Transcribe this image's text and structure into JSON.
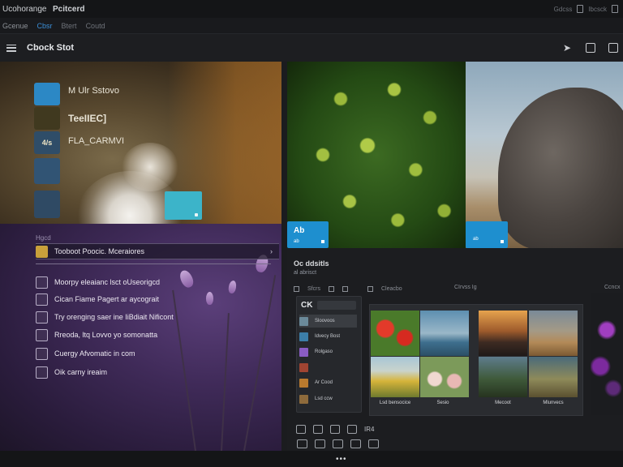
{
  "menubar": {
    "item1": "Ucohorange",
    "item2": "Pcitcerd",
    "right": [
      "Gdcss",
      "Ibcsck"
    ]
  },
  "tabbar": {
    "tabs": [
      "Gcenue",
      "Cbsr",
      "Btert",
      "Coutd"
    ]
  },
  "header": {
    "title": "Cbock Stot"
  },
  "top_left": {
    "labels": [
      "M Ulr Sstovo",
      "TeeIIEC]",
      "FLA_CARMVI"
    ],
    "tiles": [
      "",
      "",
      "4/s",
      "",
      ""
    ]
  },
  "list": {
    "heading": "Hgcd",
    "active": "Tooboot Poocic. Mceraiores",
    "items": [
      "Moorpy eleaianc lsct oUseorigcd",
      "Cican Fiame Pagert ar aycograit",
      "Try orenging saer ine IiBdiait Nificont",
      "Rreoda, ltq Lovvo yo somonatta",
      "Cuergy Afvomatic in com",
      "Oik carny ireaim"
    ]
  },
  "photos": {
    "tile_ab": "Ab",
    "tile_ab_sub": "ab",
    "tile_b_sub": "ab"
  },
  "lower": {
    "title": "Oc ddsitls",
    "subtitle": "al abrisct",
    "tools": [
      "Sfcrs",
      "Cleacbo"
    ],
    "col_heads": [
      "CIrvss Ig",
      "Ccncx"
    ],
    "library": {
      "header": "CK",
      "items": [
        "Sloovoos",
        "Idvecy Bost",
        "Rolgaso",
        "",
        "Ar Cood",
        "Lsd ccw"
      ]
    },
    "gallery_captions": [
      "Lsd bensocice",
      "Sesio",
      "Mecoot",
      "Mlunvecs"
    ]
  },
  "bottom": {
    "label": "IR4"
  },
  "colors": {
    "accent": "#1e8fcf",
    "bg": "#1b1c1f"
  }
}
